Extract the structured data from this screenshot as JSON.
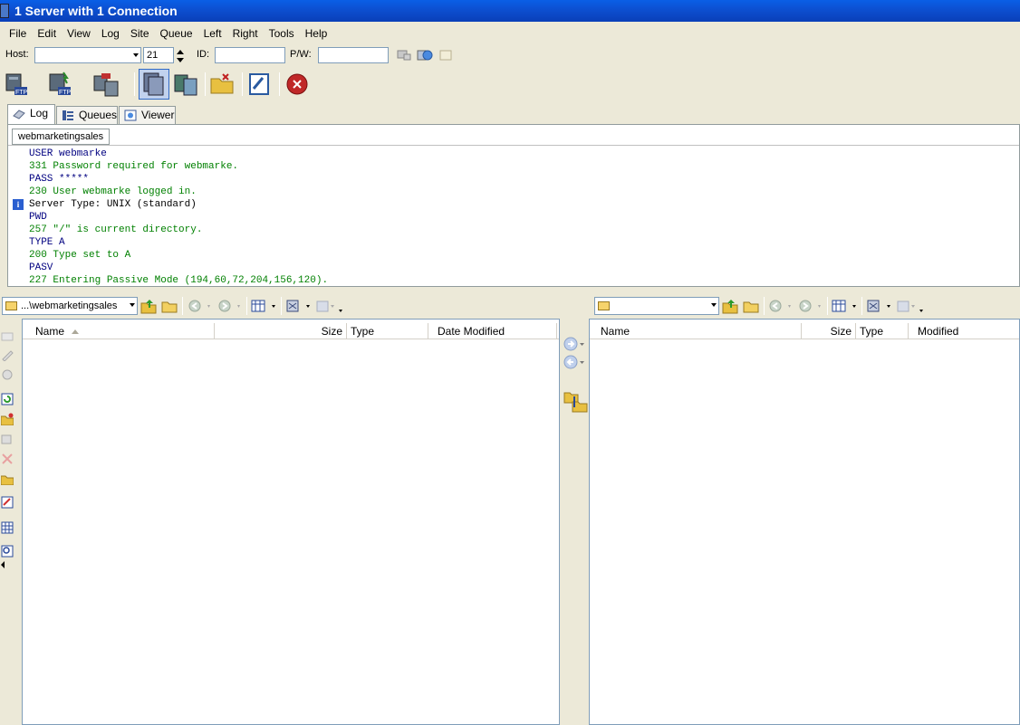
{
  "window": {
    "title": "1 Server with 1 Connection"
  },
  "menu": [
    "File",
    "Edit",
    "View",
    "Log",
    "Site",
    "Queue",
    "Left",
    "Right",
    "Tools",
    "Help"
  ],
  "connection": {
    "host_label": "Host:",
    "host_value": "",
    "port_value": "21",
    "id_label": "ID:",
    "id_value": "",
    "pw_label": "P/W:",
    "pw_value": ""
  },
  "tabs": [
    {
      "label": "Log",
      "active": true
    },
    {
      "label": "Queues",
      "active": false
    },
    {
      "label": "Viewer",
      "active": false
    }
  ],
  "log": {
    "session_tab": "webmarketingsales",
    "lines": [
      {
        "text": "USER webmarke",
        "kind": "cmd"
      },
      {
        "text": "331 Password required for webmarke.",
        "kind": "resp"
      },
      {
        "text": "PASS *****",
        "kind": "cmd"
      },
      {
        "text": "230 User webmarke logged in.",
        "kind": "resp"
      },
      {
        "text": "Server Type: UNIX (standard)",
        "kind": "info"
      },
      {
        "text": "PWD",
        "kind": "cmd"
      },
      {
        "text": "257 \"/\" is current directory.",
        "kind": "resp"
      },
      {
        "text": "TYPE A",
        "kind": "cmd"
      },
      {
        "text": "200 Type set to A",
        "kind": "resp"
      },
      {
        "text": "PASV",
        "kind": "cmd"
      },
      {
        "text": "227 Entering Passive Mode (194,60,72,204,156,120).",
        "kind": "resp"
      }
    ]
  },
  "left_pane": {
    "path": "...\\webmarketingsales",
    "columns": [
      "Name",
      "Size",
      "Type",
      "Date Modified"
    ]
  },
  "right_pane": {
    "path": "",
    "columns": [
      "Name",
      "Size",
      "Type",
      "Modified"
    ]
  },
  "colors": {
    "titlebar": "#0a52d8",
    "cmd": "#000080",
    "resp": "#008000",
    "chrome": "#ece9d8"
  }
}
